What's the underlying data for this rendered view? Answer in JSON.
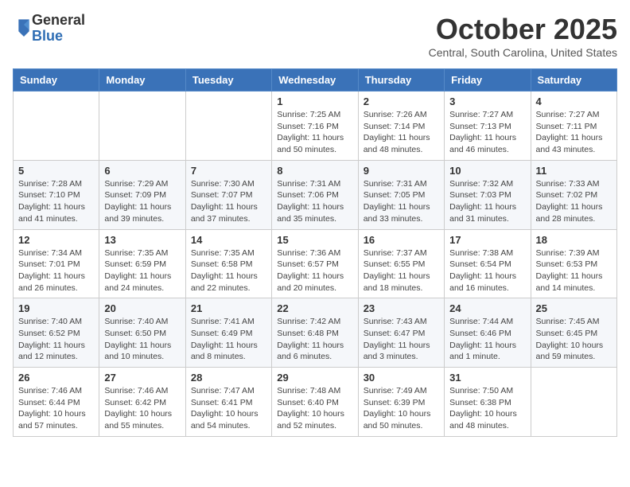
{
  "logo": {
    "general": "General",
    "blue": "Blue"
  },
  "title": "October 2025",
  "location": "Central, South Carolina, United States",
  "weekdays": [
    "Sunday",
    "Monday",
    "Tuesday",
    "Wednesday",
    "Thursday",
    "Friday",
    "Saturday"
  ],
  "weeks": [
    [
      {
        "day": "",
        "info": ""
      },
      {
        "day": "",
        "info": ""
      },
      {
        "day": "",
        "info": ""
      },
      {
        "day": "1",
        "info": "Sunrise: 7:25 AM\nSunset: 7:16 PM\nDaylight: 11 hours and 50 minutes."
      },
      {
        "day": "2",
        "info": "Sunrise: 7:26 AM\nSunset: 7:14 PM\nDaylight: 11 hours and 48 minutes."
      },
      {
        "day": "3",
        "info": "Sunrise: 7:27 AM\nSunset: 7:13 PM\nDaylight: 11 hours and 46 minutes."
      },
      {
        "day": "4",
        "info": "Sunrise: 7:27 AM\nSunset: 7:11 PM\nDaylight: 11 hours and 43 minutes."
      }
    ],
    [
      {
        "day": "5",
        "info": "Sunrise: 7:28 AM\nSunset: 7:10 PM\nDaylight: 11 hours and 41 minutes."
      },
      {
        "day": "6",
        "info": "Sunrise: 7:29 AM\nSunset: 7:09 PM\nDaylight: 11 hours and 39 minutes."
      },
      {
        "day": "7",
        "info": "Sunrise: 7:30 AM\nSunset: 7:07 PM\nDaylight: 11 hours and 37 minutes."
      },
      {
        "day": "8",
        "info": "Sunrise: 7:31 AM\nSunset: 7:06 PM\nDaylight: 11 hours and 35 minutes."
      },
      {
        "day": "9",
        "info": "Sunrise: 7:31 AM\nSunset: 7:05 PM\nDaylight: 11 hours and 33 minutes."
      },
      {
        "day": "10",
        "info": "Sunrise: 7:32 AM\nSunset: 7:03 PM\nDaylight: 11 hours and 31 minutes."
      },
      {
        "day": "11",
        "info": "Sunrise: 7:33 AM\nSunset: 7:02 PM\nDaylight: 11 hours and 28 minutes."
      }
    ],
    [
      {
        "day": "12",
        "info": "Sunrise: 7:34 AM\nSunset: 7:01 PM\nDaylight: 11 hours and 26 minutes."
      },
      {
        "day": "13",
        "info": "Sunrise: 7:35 AM\nSunset: 6:59 PM\nDaylight: 11 hours and 24 minutes."
      },
      {
        "day": "14",
        "info": "Sunrise: 7:35 AM\nSunset: 6:58 PM\nDaylight: 11 hours and 22 minutes."
      },
      {
        "day": "15",
        "info": "Sunrise: 7:36 AM\nSunset: 6:57 PM\nDaylight: 11 hours and 20 minutes."
      },
      {
        "day": "16",
        "info": "Sunrise: 7:37 AM\nSunset: 6:55 PM\nDaylight: 11 hours and 18 minutes."
      },
      {
        "day": "17",
        "info": "Sunrise: 7:38 AM\nSunset: 6:54 PM\nDaylight: 11 hours and 16 minutes."
      },
      {
        "day": "18",
        "info": "Sunrise: 7:39 AM\nSunset: 6:53 PM\nDaylight: 11 hours and 14 minutes."
      }
    ],
    [
      {
        "day": "19",
        "info": "Sunrise: 7:40 AM\nSunset: 6:52 PM\nDaylight: 11 hours and 12 minutes."
      },
      {
        "day": "20",
        "info": "Sunrise: 7:40 AM\nSunset: 6:50 PM\nDaylight: 11 hours and 10 minutes."
      },
      {
        "day": "21",
        "info": "Sunrise: 7:41 AM\nSunset: 6:49 PM\nDaylight: 11 hours and 8 minutes."
      },
      {
        "day": "22",
        "info": "Sunrise: 7:42 AM\nSunset: 6:48 PM\nDaylight: 11 hours and 6 minutes."
      },
      {
        "day": "23",
        "info": "Sunrise: 7:43 AM\nSunset: 6:47 PM\nDaylight: 11 hours and 3 minutes."
      },
      {
        "day": "24",
        "info": "Sunrise: 7:44 AM\nSunset: 6:46 PM\nDaylight: 11 hours and 1 minute."
      },
      {
        "day": "25",
        "info": "Sunrise: 7:45 AM\nSunset: 6:45 PM\nDaylight: 10 hours and 59 minutes."
      }
    ],
    [
      {
        "day": "26",
        "info": "Sunrise: 7:46 AM\nSunset: 6:44 PM\nDaylight: 10 hours and 57 minutes."
      },
      {
        "day": "27",
        "info": "Sunrise: 7:46 AM\nSunset: 6:42 PM\nDaylight: 10 hours and 55 minutes."
      },
      {
        "day": "28",
        "info": "Sunrise: 7:47 AM\nSunset: 6:41 PM\nDaylight: 10 hours and 54 minutes."
      },
      {
        "day": "29",
        "info": "Sunrise: 7:48 AM\nSunset: 6:40 PM\nDaylight: 10 hours and 52 minutes."
      },
      {
        "day": "30",
        "info": "Sunrise: 7:49 AM\nSunset: 6:39 PM\nDaylight: 10 hours and 50 minutes."
      },
      {
        "day": "31",
        "info": "Sunrise: 7:50 AM\nSunset: 6:38 PM\nDaylight: 10 hours and 48 minutes."
      },
      {
        "day": "",
        "info": ""
      }
    ]
  ]
}
